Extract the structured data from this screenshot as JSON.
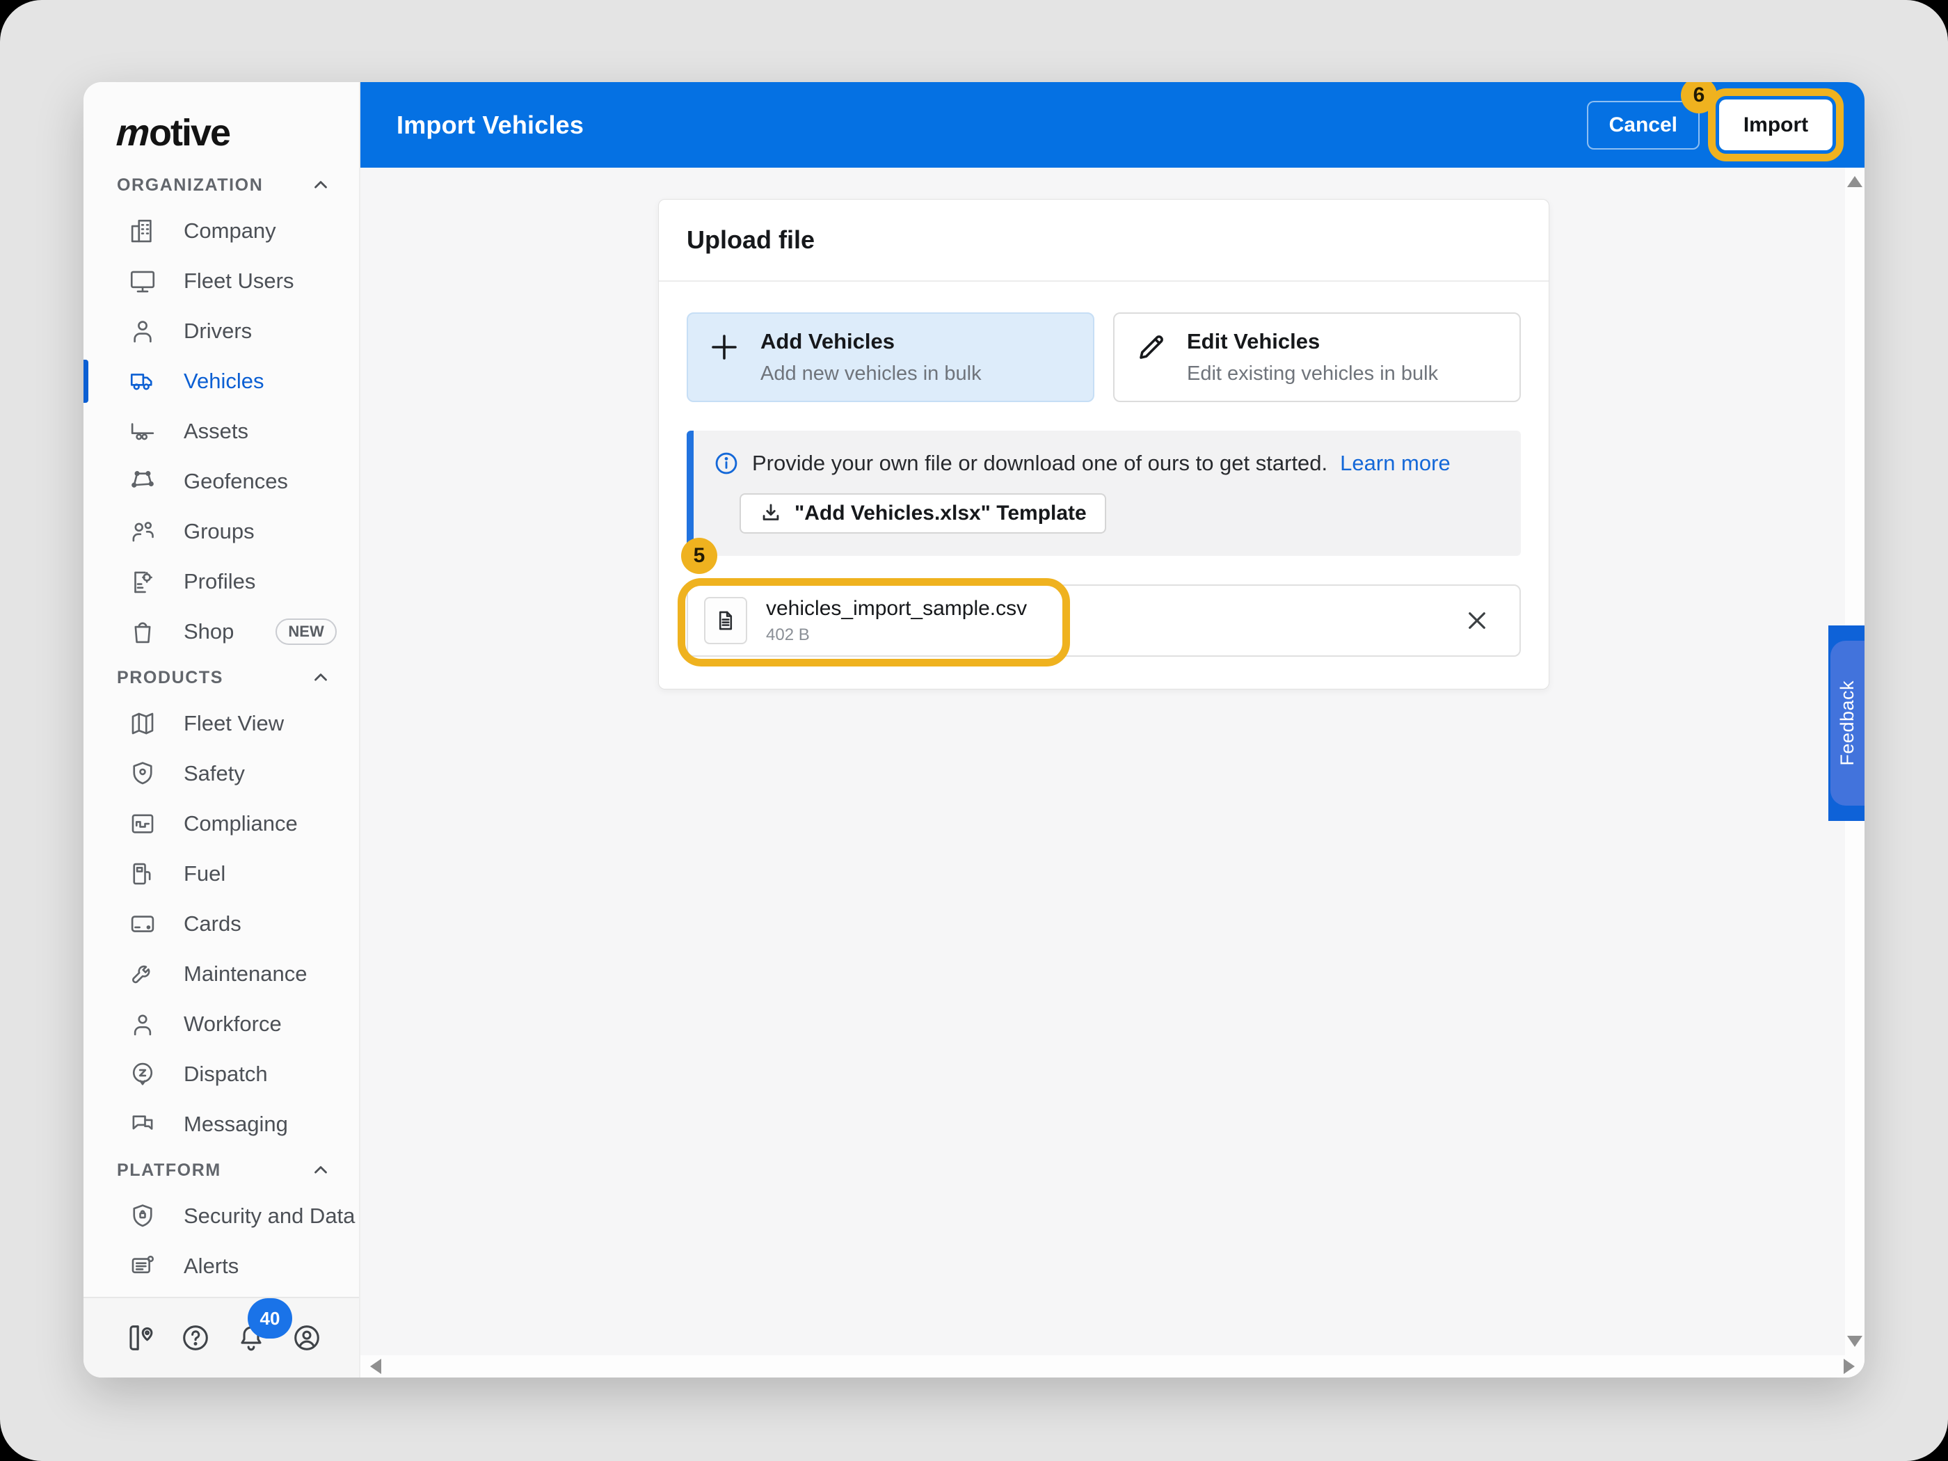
{
  "colors": {
    "header_blue": "#0571e3",
    "accent_blue": "#0b5fd3",
    "link_blue": "#1468d8",
    "selected_card_bg": "#ddecfa",
    "annotation_yellow": "#efb21f",
    "notification_blue": "#1a73e8",
    "feedback_blue": "#0e62d8"
  },
  "sidebar": {
    "logo_text": "otive",
    "logo_m": "m",
    "sections": [
      {
        "label": "ORGANIZATION",
        "items": [
          {
            "label": "Company"
          },
          {
            "label": "Fleet Users"
          },
          {
            "label": "Drivers"
          },
          {
            "label": "Vehicles"
          },
          {
            "label": "Assets"
          },
          {
            "label": "Geofences"
          },
          {
            "label": "Groups"
          },
          {
            "label": "Profiles"
          },
          {
            "label": "Shop",
            "badge": "NEW"
          }
        ]
      },
      {
        "label": "PRODUCTS",
        "items": [
          {
            "label": "Fleet View"
          },
          {
            "label": "Safety"
          },
          {
            "label": "Compliance"
          },
          {
            "label": "Fuel"
          },
          {
            "label": "Cards"
          },
          {
            "label": "Maintenance"
          },
          {
            "label": "Workforce"
          },
          {
            "label": "Dispatch"
          },
          {
            "label": "Messaging"
          }
        ]
      },
      {
        "label": "PLATFORM",
        "items": [
          {
            "label": "Security and Data"
          },
          {
            "label": "Alerts"
          }
        ]
      }
    ],
    "footer": {
      "notification_count": "40"
    }
  },
  "header": {
    "title": "Import Vehicles",
    "cancel_label": "Cancel",
    "import_label": "Import"
  },
  "annotations": {
    "step_5": "5",
    "step_6": "6"
  },
  "upload_card": {
    "title": "Upload file",
    "options": [
      {
        "title": "Add Vehicles",
        "subtitle": "Add new vehicles in bulk"
      },
      {
        "title": "Edit Vehicles",
        "subtitle": "Edit existing vehicles in bulk"
      }
    ],
    "banner": {
      "text": "Provide your own file or download one of ours to get started.",
      "link_label": "Learn more",
      "template_button_label": "\"Add Vehicles.xlsx\" Template"
    },
    "file": {
      "name": "vehicles_import_sample.csv",
      "size": "402 B"
    }
  },
  "feedback_tab_label": "Feedback"
}
